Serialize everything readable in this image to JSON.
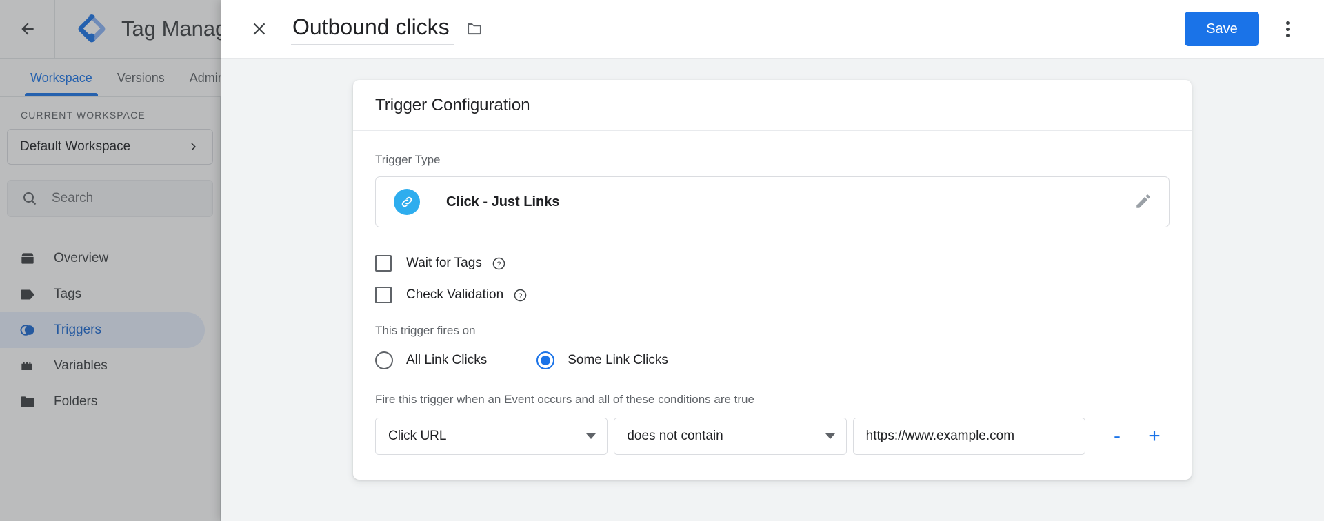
{
  "background_app": {
    "back_label": "back-arrow",
    "brand_title": "Tag Manager",
    "tabs": [
      {
        "label": "Workspace",
        "active": true
      },
      {
        "label": "Versions",
        "active": false
      },
      {
        "label": "Admin",
        "active": false
      }
    ],
    "sidebar": {
      "section_label": "CURRENT WORKSPACE",
      "workspace_name": "Default Workspace",
      "search_placeholder": "Search",
      "nav_items": [
        {
          "label": "Overview",
          "icon": "overview-icon",
          "active": false
        },
        {
          "label": "Tags",
          "icon": "tag-icon",
          "active": false
        },
        {
          "label": "Triggers",
          "icon": "trigger-icon",
          "active": true
        },
        {
          "label": "Variables",
          "icon": "variables-icon",
          "active": false
        },
        {
          "label": "Folders",
          "icon": "folder-icon",
          "active": false
        }
      ]
    }
  },
  "modal": {
    "close_icon": "close-icon",
    "title": "Outbound clicks",
    "folder_icon": "folder-icon",
    "save_label": "Save",
    "more_icon": "more-vert-icon",
    "card": {
      "heading": "Trigger Configuration",
      "trigger_type_label": "Trigger Type",
      "trigger_type_value": "Click - Just Links",
      "trigger_type_icon": "link-icon",
      "edit_icon": "pencil-icon",
      "checkboxes": [
        {
          "label": "Wait for Tags",
          "checked": false,
          "help": "help-icon"
        },
        {
          "label": "Check Validation",
          "checked": false,
          "help": "help-icon"
        }
      ],
      "fires_on_label": "This trigger fires on",
      "radios": [
        {
          "label": "All Link Clicks",
          "selected": false
        },
        {
          "label": "Some Link Clicks",
          "selected": true
        }
      ],
      "conditions_label": "Fire this trigger when an Event occurs and all of these conditions are true",
      "condition": {
        "variable": "Click URL",
        "operator": "does not contain",
        "value": "https://www.example.com",
        "remove_label": "-",
        "add_label": "+"
      }
    }
  },
  "colors": {
    "accent_blue": "#1a73e8",
    "active_nav_bg": "#e8f0fe",
    "active_nav_text": "#1967d2",
    "trigger_icon_blue": "#2eadee",
    "panel_bg": "#f1f3f4"
  }
}
